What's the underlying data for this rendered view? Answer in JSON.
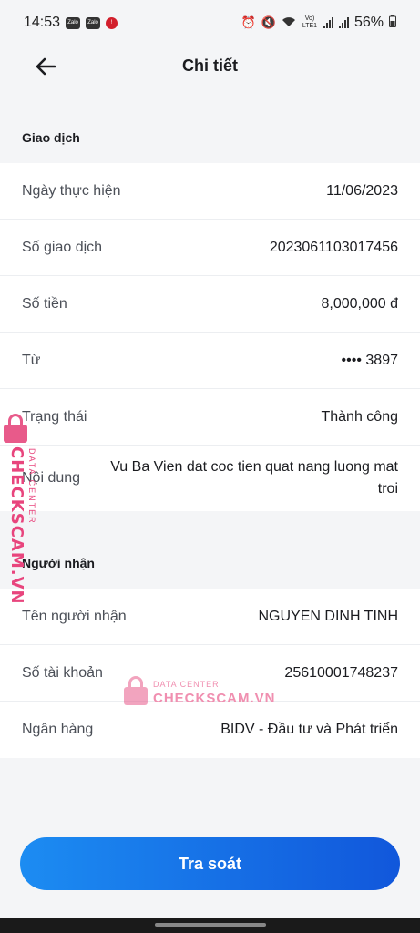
{
  "status_bar": {
    "time": "14:53",
    "app_badges": [
      "Zalo",
      "Zalo",
      "!"
    ],
    "network_label": "Vo) LTE1",
    "battery": "56%"
  },
  "header": {
    "title": "Chi tiết"
  },
  "transaction_section": {
    "title": "Giao dịch",
    "rows": [
      {
        "label": "Ngày thực hiện",
        "value": "11/06/2023"
      },
      {
        "label": "Số giao dịch",
        "value": "2023061103017456"
      },
      {
        "label": "Số tiền",
        "value": "8,000,000 đ"
      },
      {
        "label": "Từ",
        "value": "•••• 3897"
      },
      {
        "label": "Trạng thái",
        "value": "Thành công"
      },
      {
        "label": "Nội dung",
        "value": "Vu Ba Vien dat coc tien quat nang luong mat troi"
      }
    ]
  },
  "recipient_section": {
    "title": "Người nhận",
    "rows": [
      {
        "label": "Tên người nhận",
        "value": "NGUYEN DINH TINH"
      },
      {
        "label": "Số tài khoản",
        "value": "25610001748237"
      },
      {
        "label": "Ngân hàng",
        "value": "BIDV - Đầu tư và Phát triển"
      }
    ]
  },
  "watermark": {
    "brand": "CHECKSCAM.VN",
    "tagline": "DATA CENTER"
  },
  "actions": {
    "primary_label": "Tra soát"
  },
  "colors": {
    "accent_start": "#1c8cf2",
    "accent_end": "#1157db",
    "watermark": "#e8457d"
  }
}
